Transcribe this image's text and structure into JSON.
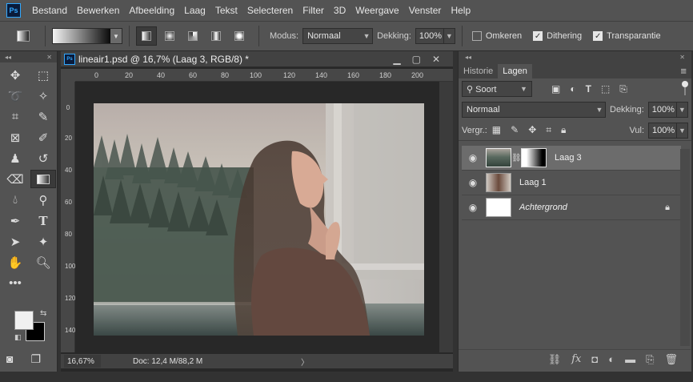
{
  "app": {
    "logo": "Ps"
  },
  "menu": [
    "Bestand",
    "Bewerken",
    "Afbeelding",
    "Laag",
    "Tekst",
    "Selecteren",
    "Filter",
    "3D",
    "Weergave",
    "Venster",
    "Help"
  ],
  "options": {
    "mode_label": "Modus:",
    "mode_value": "Normaal",
    "opacity_label": "Dekking:",
    "opacity_value": "100%",
    "reverse_label": "Omkeren",
    "reverse_checked": false,
    "dither_label": "Dithering",
    "dither_checked": true,
    "transparency_label": "Transparantie",
    "transparency_checked": true
  },
  "document": {
    "title": "lineair1.psd @ 16,7% (Laag 3, RGB/8) *",
    "ruler_top": [
      "0",
      "20",
      "40",
      "60",
      "80",
      "100",
      "120",
      "140",
      "160",
      "180",
      "200"
    ],
    "ruler_left": [
      "0",
      "20",
      "40",
      "60",
      "80",
      "100",
      "120",
      "140"
    ],
    "zoom": "16,67%",
    "doc_info": "Doc: 12,4 M/88,2 M"
  },
  "panel": {
    "tabs": [
      "Historie",
      "Lagen"
    ],
    "active_tab": "Lagen",
    "filter_value": "Soort",
    "blend_mode": "Normaal",
    "opacity_label": "Dekking:",
    "opacity_value": "100%",
    "lock_label": "Vergr.:",
    "fill_label": "Vul:",
    "fill_value": "100%",
    "layers": [
      {
        "name": "Laag 3",
        "selected": true,
        "has_mask": true
      },
      {
        "name": "Laag 1",
        "selected": false,
        "has_mask": false
      },
      {
        "name": "Achtergrond",
        "selected": false,
        "has_mask": false,
        "locked": true
      }
    ]
  },
  "colors": {
    "foreground": "#f0f0f0",
    "background": "#000000",
    "accent": "#31a8ff"
  }
}
